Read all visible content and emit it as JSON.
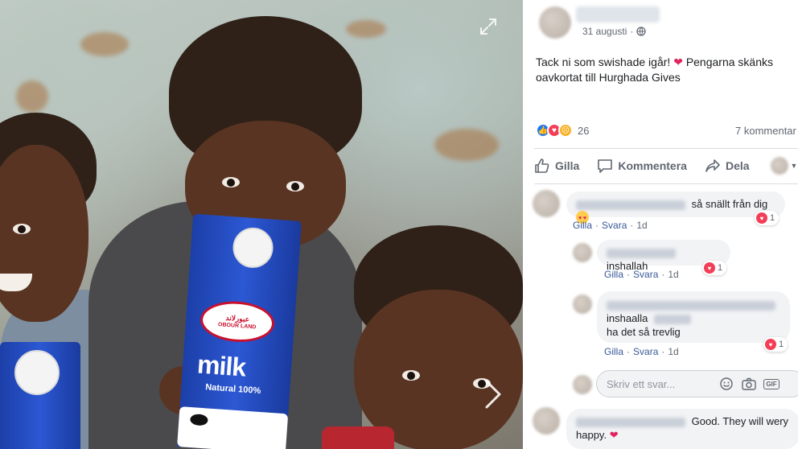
{
  "photo": {
    "carton_brand_arabic": "عبورلاند",
    "carton_brand_latin": "OBOUR LAND",
    "carton_milk": "milk",
    "carton_sub": "Natural 100%"
  },
  "post": {
    "date": "31 augusti",
    "audience_icon": "globe-icon",
    "text_before_heart": "Tack ni som swishade igår!",
    "text_after_heart": "Pengarna skänks oavkortat till Hurghada Gives",
    "reaction_count": "26",
    "comments_count": "7 kommentar"
  },
  "actions": {
    "like": "Gilla",
    "comment": "Kommentera",
    "share": "Dela"
  },
  "comments": [
    {
      "text": "så snällt från dig",
      "likes": "1",
      "like_label": "Gilla",
      "reply_label": "Svara",
      "time": "1d"
    },
    {
      "text": "inshallah",
      "likes": "1",
      "like_label": "Gilla",
      "reply_label": "Svara",
      "time": "1d"
    },
    {
      "line1": "inshaalla",
      "line2": "ha det så trevlig",
      "likes": "1",
      "like_label": "Gilla",
      "reply_label": "Svara",
      "time": "1d"
    },
    {
      "text_a": "Good. They will wery",
      "text_b": "happy."
    }
  ],
  "reply_box": {
    "placeholder": "Skriv ett svar..."
  },
  "colors": {
    "link": "#385898",
    "like_blue": "#2078f4",
    "love_red": "#f33e58",
    "sad_yellow": "#f7b125"
  }
}
